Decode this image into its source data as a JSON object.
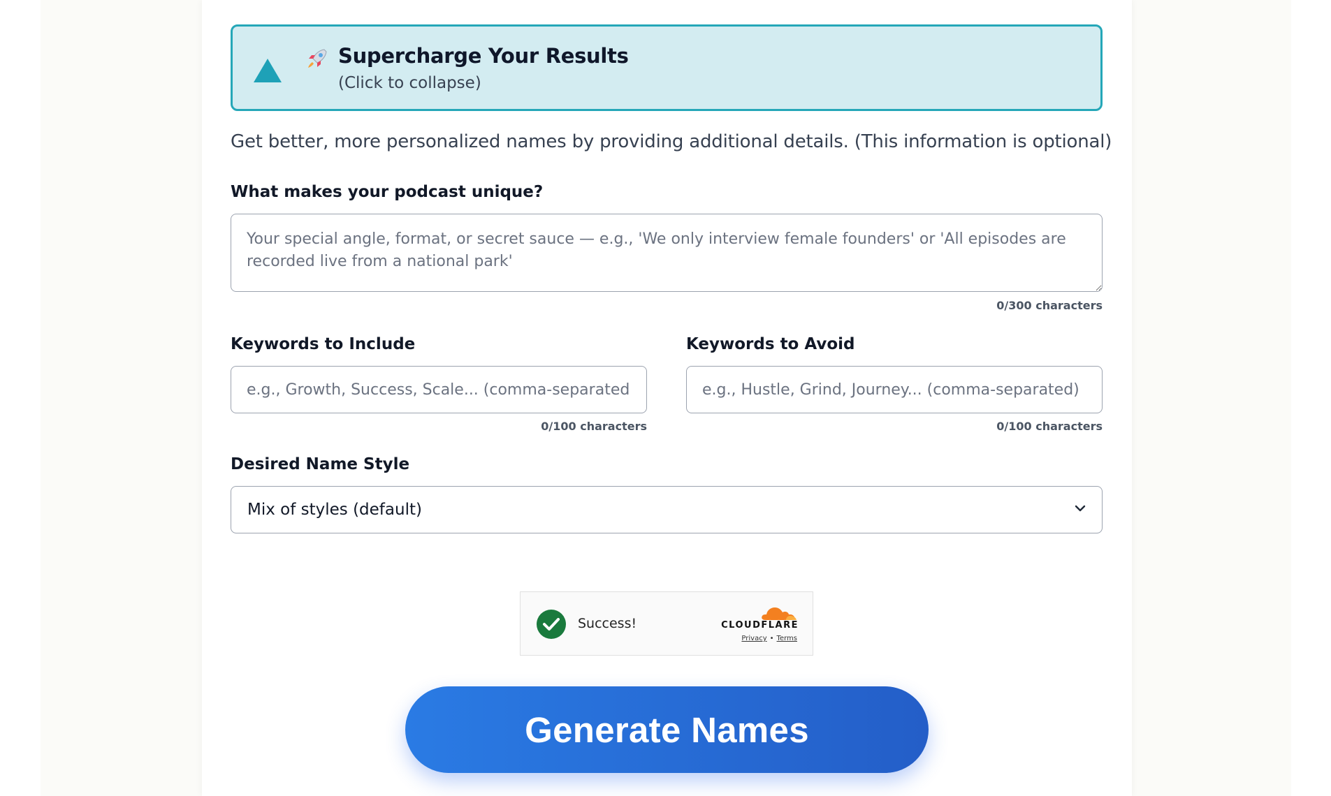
{
  "panel": {
    "title": "Supercharge Your Results",
    "subtitle": "(Click to collapse)",
    "icon": "rocket-icon",
    "toggle_icon": "triangle-up-icon"
  },
  "intro_text": "Get better, more personalized names by providing additional details. (This information is optional)",
  "unique": {
    "label": "What makes your podcast unique?",
    "value": "",
    "placeholder": "Your special angle, format, or secret sauce — e.g., 'We only interview female founders' or 'All episodes are recorded live from a national park'",
    "counter": "0/300 characters"
  },
  "keywords_include": {
    "label": "Keywords to Include",
    "value": "",
    "placeholder": "e.g., Growth, Success, Scale... (comma-separated)",
    "counter": "0/100 characters"
  },
  "keywords_avoid": {
    "label": "Keywords to Avoid",
    "value": "",
    "placeholder": "e.g., Hustle, Grind, Journey... (comma-separated)",
    "counter": "0/100 characters"
  },
  "name_style": {
    "label": "Desired Name Style",
    "selected": "Mix of styles (default)"
  },
  "captcha": {
    "status": "Success!",
    "brand": "CLOUDFLARE",
    "privacy": "Privacy",
    "separator": "•",
    "terms": "Terms"
  },
  "generate_button": "Generate Names",
  "colors": {
    "panel_bg": "#d3ecf1",
    "panel_border": "#25a7b8",
    "button": "#2a7be4",
    "success": "#1a7a3d",
    "cloudflare": "#f38020"
  }
}
